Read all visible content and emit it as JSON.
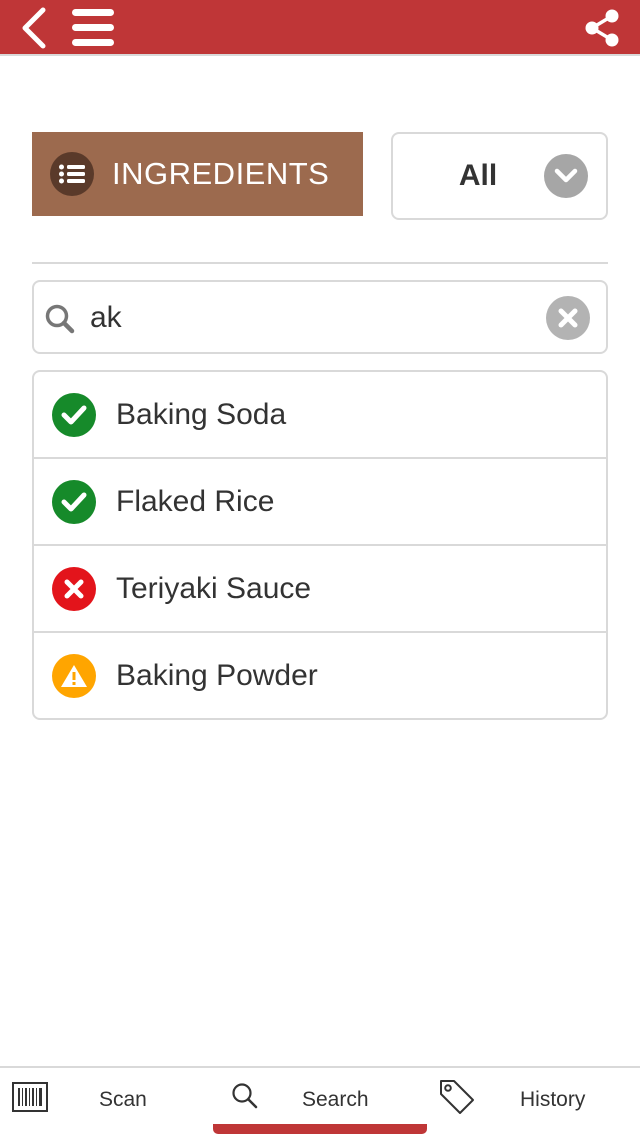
{
  "header": {
    "background_color": "#bf3637",
    "back_icon": "chevron-left-icon",
    "menu_icon": "hamburger-icon",
    "share_icon": "share-icon"
  },
  "category": {
    "label": "INGREDIENTS",
    "icon": "list-icon",
    "color": "#9c6a4e"
  },
  "filter": {
    "selected": "All",
    "icon": "chevron-down-icon"
  },
  "search": {
    "value": "ak",
    "icon": "search-icon",
    "clear_icon": "clear-icon"
  },
  "results": [
    {
      "name": "Baking Soda",
      "status": "ok",
      "icon": "check-icon",
      "color": "#168a2a"
    },
    {
      "name": "Flaked Rice",
      "status": "ok",
      "icon": "check-icon",
      "color": "#168a2a"
    },
    {
      "name": "Teriyaki Sauce",
      "status": "bad",
      "icon": "x-icon",
      "color": "#e3141b"
    },
    {
      "name": "Baking Powder",
      "status": "warn",
      "icon": "warning-icon",
      "color": "#ffa500"
    }
  ],
  "bottom_nav": {
    "items": [
      {
        "label": "Scan",
        "icon": "barcode-icon"
      },
      {
        "label": "Search",
        "icon": "search-icon",
        "active": true
      },
      {
        "label": "History",
        "icon": "tag-icon"
      }
    ],
    "active_color": "#bf3637"
  }
}
